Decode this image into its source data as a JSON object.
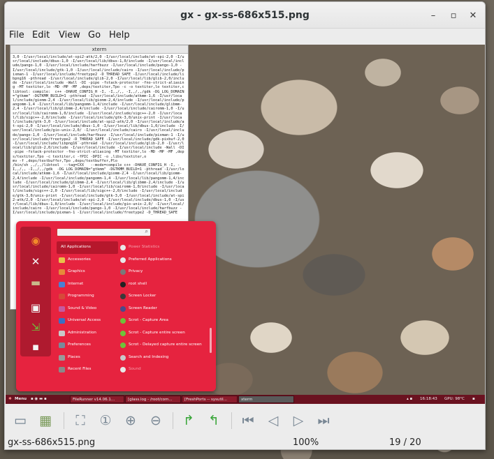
{
  "window": {
    "title": "gx - gx-ss-686x515.png"
  },
  "menubar": {
    "items": [
      "File",
      "Edit",
      "View",
      "Go",
      "Help"
    ]
  },
  "screenshot": {
    "xterm": {
      "title": "xterm",
      "text": "3,0 -I/usr/local/include/at-spi2-atk/2,0 -I/usr/local/include/at-spi-2,0 -I/usr/local/include/dbus-1,0 -I/usr/local/lib/dbus-1,0/include -I/usr/local/include/pango-1,0 -I/usr/local/include/harfbuzz -I/usr/local/include/pango-1,0 -I/usr/local/include/gtk-1,0 -I/usr/local/include/cairo -I/usr/local/include/pixman-1 -I/usr/local/include/freetype2 -D_THREAD_SAFE -I/usr/local/include/libpng16 -pthread -I/usr/local/include/glib-2,0 -I/usr/local/lib/glib-2,0/include -I/usr/local/include -Wall -DI -pipe -fstack-protector -fno-strict-aliasing -MT textiter,lo -MD -MP -MF ,deps/textiter,Tpo -c -o textiter,lo textiter,c\nlibtool: compile:  c++ -DHAVE_CONFIG_H -I, -I,,/,, -I,,/,,/gdk -DG_LOG_DOMAIN=\"gtkmm\" -DGTKMM_BUILD=1 -pthread -I/usr/local/include/atkmm-1,6 -I/usr/local/include/giomm-2,4 -I/usr/local/lib/giomm-2,4/include -I/usr/local/include/pangomm-1,4 -I/usr/local/lib/pangomm-1,4/include -I/usr/local/include/glibmm-2,4 -I/usr/local/lib/glibmm-2,4/include -I/usr/local/include/cairomm-1,0 -I/usr/local/lib/cairomm-1,0/include -I/usr/local/include/sigc++-2,0 -I/usr/local/lib/sigc++-2,0/include -I/usr/local/include/gtk-3,0/unix-print -I/usr/local/include/gtk-3,0 -I/usr/local/include/at-spi2-atk/2,0 -I/usr/local/include/at-spi-2,0 -I/usr/local/include/dbus-1,0 -I/usr/local/lib/dbus-1,0/include -I/usr/local/include/gio-unix-2,0/ -I/usr/local/include/cairo -I/usr/local/include/pango-1,0 -I/usr/local/include/harfbuzz -I/usr/local/include/pixman-1 -I/usr/local/include/freetype2 -D_THREAD_SAFE -I/usr/local/include/gdk-pixbuf-2,0 -I/usr/local/include/libpng16 -pthread -I/usr/local/include/glib-2,0 -I/usr/local/lib/glib-2,0/include -I/usr/local/include -I/usr/local/include -Wall -DI -pipe -fstack-protector -fno-strict-aliasing -MT textiter,lo -MD -MP -MF ,deps/textiter,Tpo -c textiter,c -fPIC -DPIC -o ,libs/textiter,o\nmv -f ,deps/textbuffer,Tpo ,deps/textbuffer,Plo\n/bin/sh ,,/,,/libtool  --tag=CXX   --mode=compile c++ -DHAVE_CONFIG_H -I, -I,,/,, -I,,/,,/gdk  -DG_LOG_DOMAIN=\"gtkmm\" -DGTKMM_BUILD=1 -pthread -I/usr/local/include/atkmm-1,6 -I/usr/local/include/giomm-2,4 -I/usr/local/lib/giomm-2,4/include -I/usr/local/include/pangomm-1,4 -I/usr/local/lib/pangomm-1,4/include -I/usr/local/include/glibmm-2,4 -I/usr/local/lib/glibmm-2,4/include -I/usr/local/include/cairomm-1,0 -I/usr/local/lib/cairomm-1,0/include -I/usr/local/include/sigc++-2,0 -I/usr/local/lib/sigc++-2,0/include -I/usr/local/include/gtk-3,0/unix-print -I/usr/local/include/gtk-3,0 -I/usr/local/include/at-spi2-atk/2,0 -I/usr/local/include/at-spi-2,0 -I/usr/local/include/dbus-1,0 -I/usr/local/lib/dbus-1,0/include -I/usr/local/include/gio-unix-2,0/ -I/usr/local/include/cairo -I/usr/local/include/pango-1,0 -I/usr/local/include/harfbuzz -I/usr/local/include/pixman-1 -I/usr/local/include/freetype2 -D_THREAD_SAFE"
    },
    "app_menu": {
      "search_placeholder": "",
      "categories": [
        "All Applications",
        "Accessories",
        "Graphics",
        "Internet",
        "Programming",
        "Sound & Video",
        "Universal Access",
        "Administration",
        "Preferences",
        "Places",
        "Recent Files"
      ],
      "category_colors": [
        "",
        "#e8c24a",
        "#e68a3a",
        "#4a7fd4",
        "#d64a3a",
        "#c55aa0",
        "#3a6fc4",
        "#c9c9c9",
        "#7a8a9a",
        "#9a9a9a",
        "#8a8a8a"
      ],
      "apps": [
        {
          "label": "Power Statistics",
          "dim": true
        },
        {
          "label": "Preferred Applications",
          "dim": false
        },
        {
          "label": "Privacy",
          "dim": false
        },
        {
          "label": "root shell",
          "dim": false
        },
        {
          "label": "Screen Locker",
          "dim": false
        },
        {
          "label": "Screen Reader",
          "dim": false
        },
        {
          "label": "Scrot - Capture Area",
          "dim": false
        },
        {
          "label": "Scrot - Capture entire screen",
          "dim": false
        },
        {
          "label": "Scrot - Delayed capture entire screen",
          "dim": false
        },
        {
          "label": "Search and Indexing",
          "dim": false
        },
        {
          "label": "Sound",
          "dim": true
        }
      ],
      "app_icon_colors": [
        "#e8e8e8",
        "#e8e8e8",
        "#7a7a7a",
        "#222222",
        "#3a3a3a",
        "#4a4a8a",
        "#6fc23a",
        "#6fc23a",
        "#6fc23a",
        "#c9c9c9",
        "#e8e8e8"
      ]
    },
    "panel": {
      "menu_label": "Menu",
      "tasks": [
        "FileRunner v14.06.1...",
        "[glass.log - /root/com...",
        "[FreshPorts -- sysutil...",
        "xterm"
      ],
      "clock": "16:18:43",
      "gpu": "GPU: 98°C"
    }
  },
  "statusbar": {
    "filename": "gx-ss-686x515.png",
    "zoom": "100%",
    "position": "19 / 20"
  }
}
